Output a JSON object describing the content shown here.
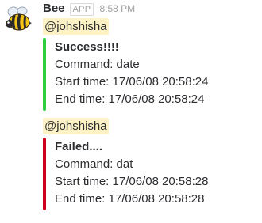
{
  "message": {
    "sender": "Bee",
    "app_badge": "APP",
    "time": "8:58 PM",
    "avatar_icon": "bee-icon",
    "posts": [
      {
        "mention": "@johshisha",
        "attachment": {
          "color": "#2ecc40",
          "title": "Success!!!!",
          "lines": [
            "Command: date",
            "Start time: 17/06/08 20:58:24",
            "End time: 17/06/08 20:58:24"
          ]
        }
      },
      {
        "mention": "@johshisha",
        "attachment": {
          "color": "#d0021b",
          "title": "Failed....",
          "lines": [
            "Command: dat",
            "Start time: 17/06/08 20:58:28",
            "End time: 17/06/08 20:58:28"
          ]
        }
      }
    ]
  }
}
